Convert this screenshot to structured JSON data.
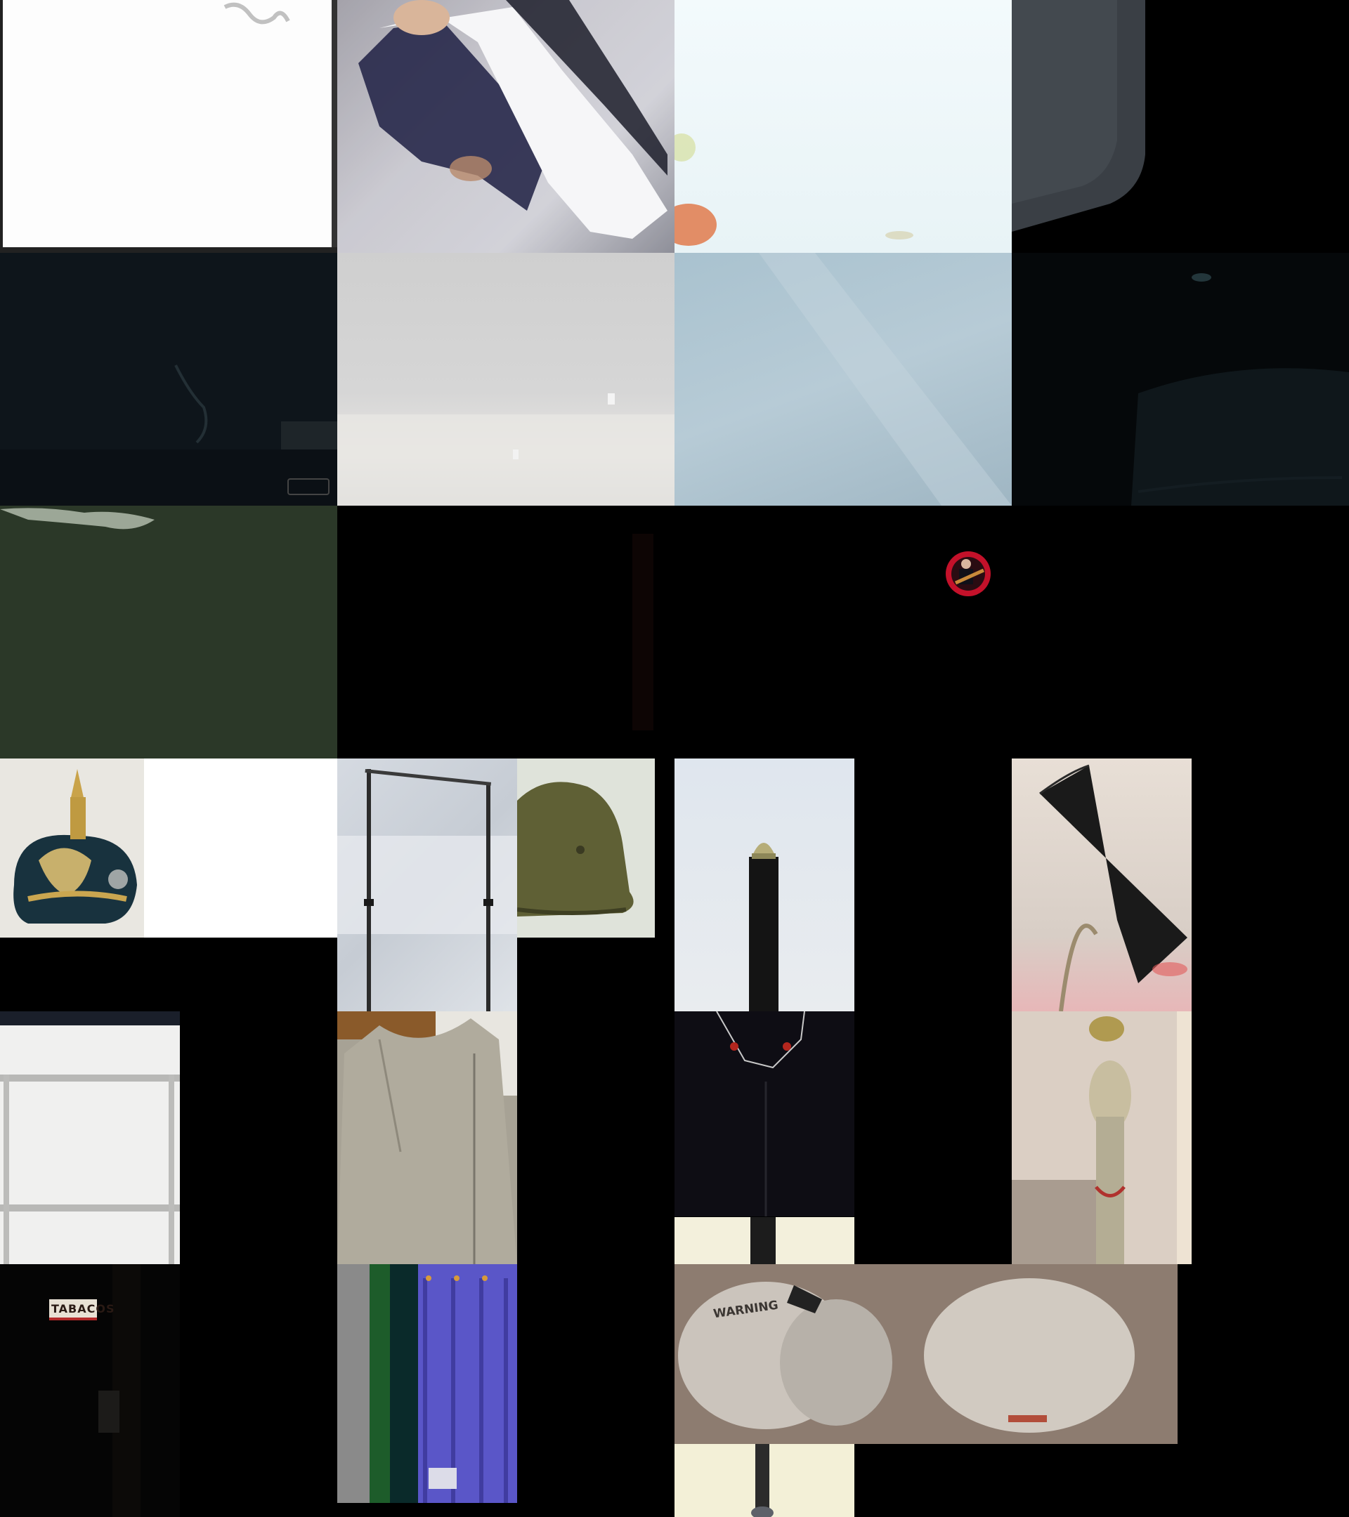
{
  "collage": {
    "sign_text": "TABACOS",
    "mask_label": "WARNING",
    "colors": {
      "background": "#000000",
      "sky_light": "#eef6f8",
      "haze_blue": "#a6bfcc",
      "dark_green": "#2a3626",
      "lamp_black": "#1a1a1a",
      "curtain_purple": "#5550c4"
    }
  }
}
